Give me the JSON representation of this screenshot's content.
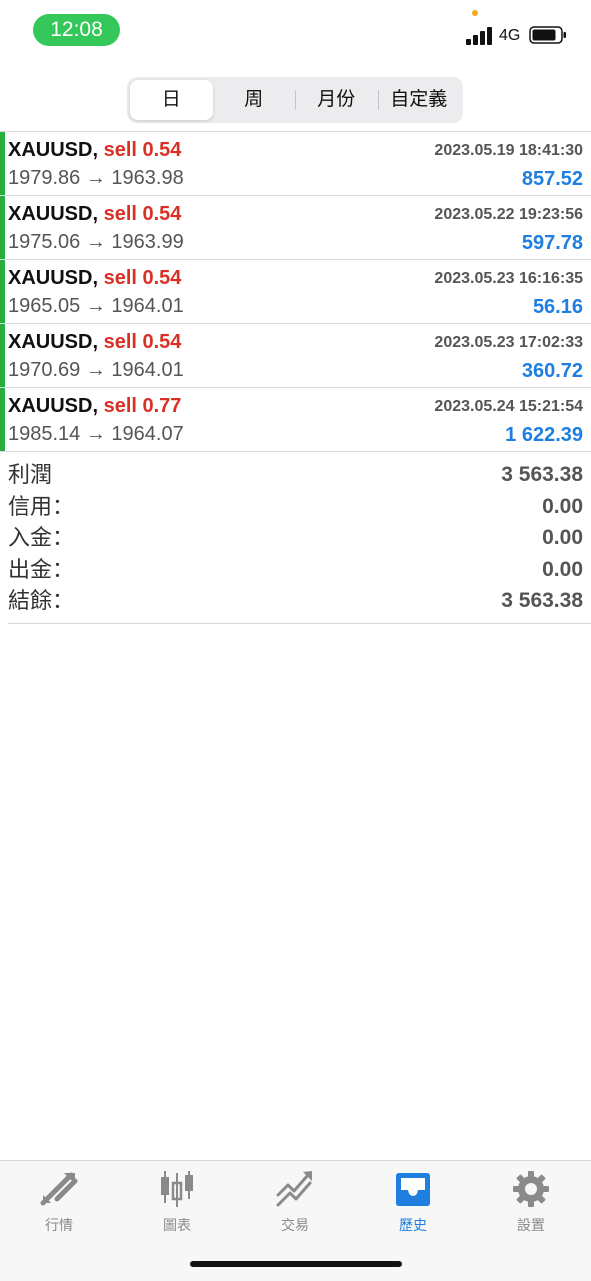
{
  "status_bar": {
    "time": "12:08",
    "network": "4G"
  },
  "period_tabs": [
    {
      "label": "日",
      "active": true
    },
    {
      "label": "周",
      "active": false
    },
    {
      "label": "月份",
      "active": false
    },
    {
      "label": "自定義",
      "active": false
    }
  ],
  "deals": [
    {
      "symbol": "XAUUSD,",
      "type": "sell 0.54",
      "time": "2023.05.19 18:41:30",
      "prices": "1979.86 → 1963.98",
      "profit": "857.52"
    },
    {
      "symbol": "XAUUSD,",
      "type": "sell 0.54",
      "time": "2023.05.22 19:23:56",
      "prices": "1975.06 → 1963.99",
      "profit": "597.78"
    },
    {
      "symbol": "XAUUSD,",
      "type": "sell 0.54",
      "time": "2023.05.23 16:16:35",
      "prices": "1965.05 → 1964.01",
      "profit": "56.16"
    },
    {
      "symbol": "XAUUSD,",
      "type": "sell 0.54",
      "time": "2023.05.23 17:02:33",
      "prices": "1970.69 → 1964.01",
      "profit": "360.72"
    },
    {
      "symbol": "XAUUSD,",
      "type": "sell 0.77",
      "time": "2023.05.24 15:21:54",
      "prices": "1985.14 → 1964.07",
      "profit": "1 622.39"
    }
  ],
  "summary": [
    {
      "label": "利潤",
      "value": "3 563.38"
    },
    {
      "label": "信用：",
      "value": "0.00"
    },
    {
      "label": "入金：",
      "value": "0.00"
    },
    {
      "label": "出金：",
      "value": "0.00"
    },
    {
      "label": "結餘：",
      "value": "3 563.38"
    }
  ],
  "tab_bar": {
    "items": [
      {
        "label": "行情",
        "icon": "quotes-arrows-icon",
        "active": false
      },
      {
        "label": "圖表",
        "icon": "candlestick-chart-icon",
        "active": false
      },
      {
        "label": "交易",
        "icon": "trade-trend-icon",
        "active": false
      },
      {
        "label": "歷史",
        "icon": "history-inbox-icon",
        "active": true
      },
      {
        "label": "設置",
        "icon": "gear-icon",
        "active": false
      }
    ]
  },
  "colors": {
    "accent": "#1e7fe0",
    "sell": "#d93025",
    "buy_bar": "#27ae3f",
    "time_pill": "#34c759"
  }
}
